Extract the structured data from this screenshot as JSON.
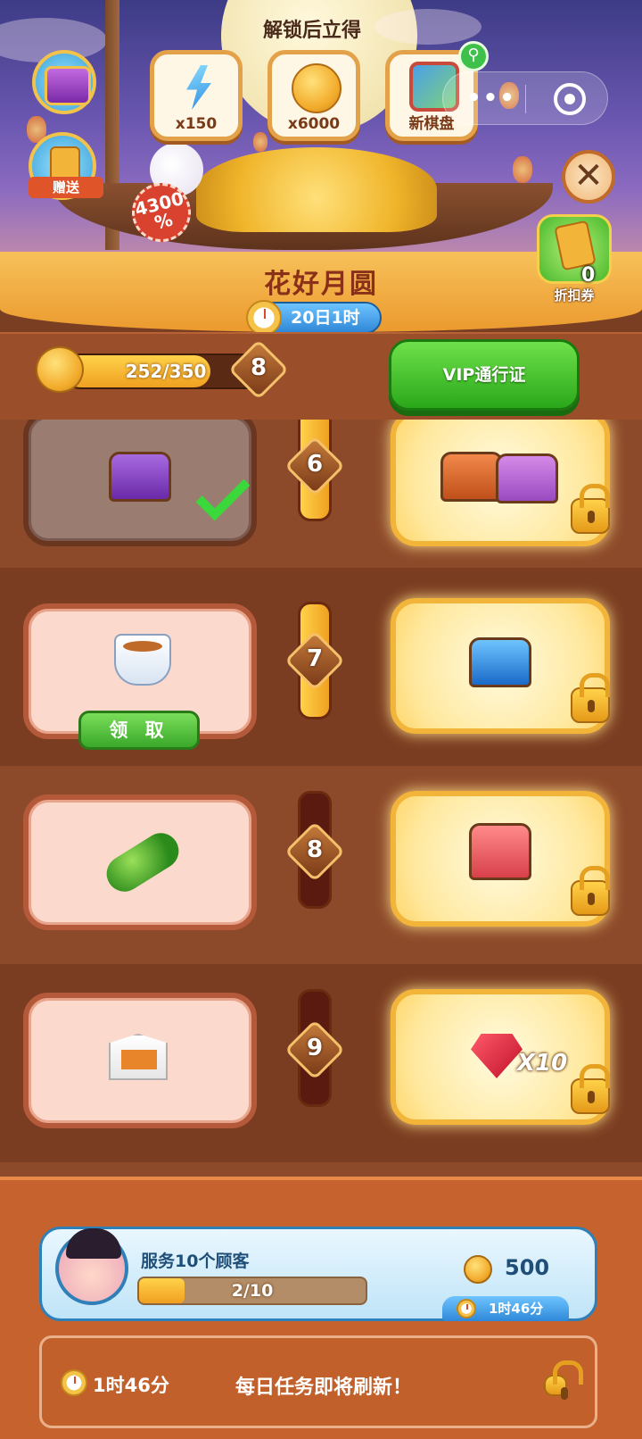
{
  "header": {
    "unlock_label": "解锁后立得",
    "rewards": [
      {
        "icon": "energy-bolt-icon",
        "label": "x150"
      },
      {
        "icon": "mooncake-coin-icon",
        "label": "x6000"
      },
      {
        "icon": "game-board-icon",
        "label": "新棋盘"
      }
    ],
    "gift_label": "赠送",
    "percent_badge": "4300\n%",
    "close_symbol": "✕"
  },
  "event": {
    "title": "花好月圆",
    "timer": "20日1时"
  },
  "coupon": {
    "count": "0",
    "label": "折扣券"
  },
  "progress": {
    "text": "252/350",
    "current": 252,
    "max": 350,
    "level": "8"
  },
  "vip_button": "VIP通行证",
  "rows": [
    {
      "level": "6",
      "free_item": "purple-chest-icon",
      "free_state": "claimed",
      "vip_item": "treasure-chests-icon",
      "track_active": true
    },
    {
      "level": "7",
      "free_item": "tea-cup-icon",
      "free_state": "claim",
      "claim_label": "领 取",
      "vip_item": "blue-chest-icon",
      "track_active": true
    },
    {
      "level": "8",
      "free_item": "cucumber-icon",
      "free_state": "locked",
      "vip_item": "red-mystery-chest-icon",
      "track_active": false
    },
    {
      "level": "9",
      "free_item": "takeout-box-icon",
      "free_state": "locked",
      "vip_item": "ruby-gem-icon",
      "vip_count": "X10",
      "track_active": false
    }
  ],
  "task": {
    "title": "服务10个顾客",
    "progress_text": "2/10",
    "current": 2,
    "max": 10,
    "reward": "500",
    "time": "1时46分"
  },
  "daily": {
    "time": "1时46分",
    "message": "每日任务即将刷新！"
  },
  "colors": {
    "accent_gold": "#f2b53a",
    "vip_green": "#3aa82a",
    "timer_blue": "#2f88d8",
    "panel_brown": "#7b3d21"
  }
}
